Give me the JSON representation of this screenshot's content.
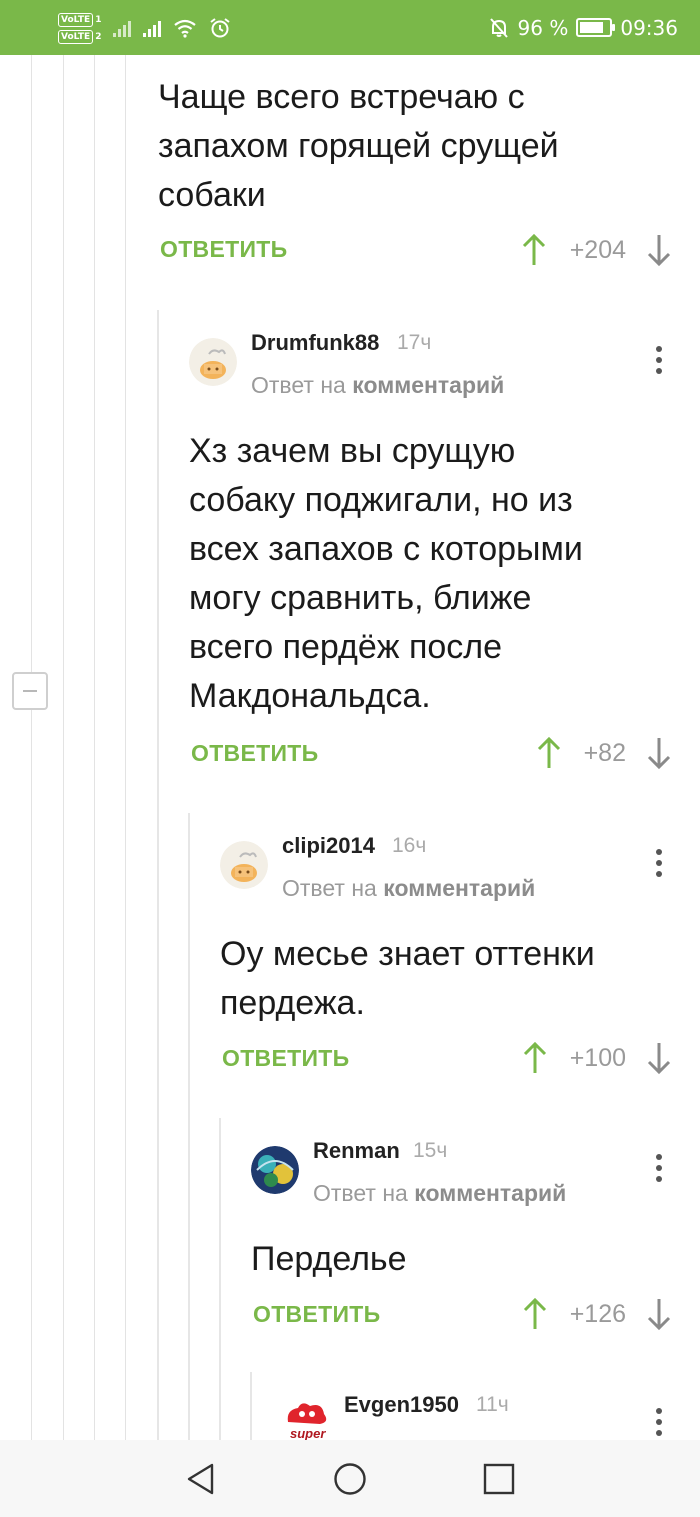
{
  "status_bar": {
    "volte1": "VoLTE",
    "sim1": "1",
    "volte2": "VoLTE",
    "sim2": "2",
    "battery": "96 %",
    "battery_level": 0.96,
    "time": "09:36",
    "icons": [
      "signal-icon",
      "signal-icon",
      "wifi-icon",
      "alarm-icon",
      "mute-icon",
      "battery-icon"
    ]
  },
  "thread": {
    "collapse_icon": "minus-icon",
    "parent": {
      "text_lines": [
        "Чаще всего встречаю с",
        "запахом горящей срущей",
        "собаки"
      ],
      "reply_label": "ОТВЕТИТЬ",
      "rating": "+204"
    },
    "comments": [
      {
        "username": "Drumfunk88",
        "time": "17ч",
        "reply_prefix": "Ответ на",
        "reply_target": "комментарий",
        "text_lines": [
          "Хз зачем вы срущую",
          "собаку поджигали, но из",
          "всех запахов с которыми",
          "могу сравнить, ближе",
          "всего пердёж после",
          "Макдональдса."
        ],
        "reply_label": "ОТВЕТИТЬ",
        "rating": "+82"
      },
      {
        "username": "clipi2014",
        "time": "16ч",
        "reply_prefix": "Ответ на",
        "reply_target": "комментарий",
        "text_lines": [
          "Оу месье знает оттенки",
          "пердежа."
        ],
        "reply_label": "ОТВЕТИТЬ",
        "rating": "+100"
      },
      {
        "username": "Renman",
        "time": "15ч",
        "reply_prefix": "Ответ на",
        "reply_target": "комментарий",
        "text_lines": [
          "Перделье"
        ],
        "reply_label": "ОТВЕТИТЬ",
        "rating": "+126"
      },
      {
        "username": "Evgen1950",
        "time": "11ч",
        "avatar_text": "super"
      }
    ]
  },
  "nav": {
    "back": "back-icon",
    "home": "home-icon",
    "recents": "recents-icon"
  },
  "colors": {
    "accent": "#7ab849",
    "text": "#1b1b1b",
    "muted": "#9a9a9a"
  }
}
